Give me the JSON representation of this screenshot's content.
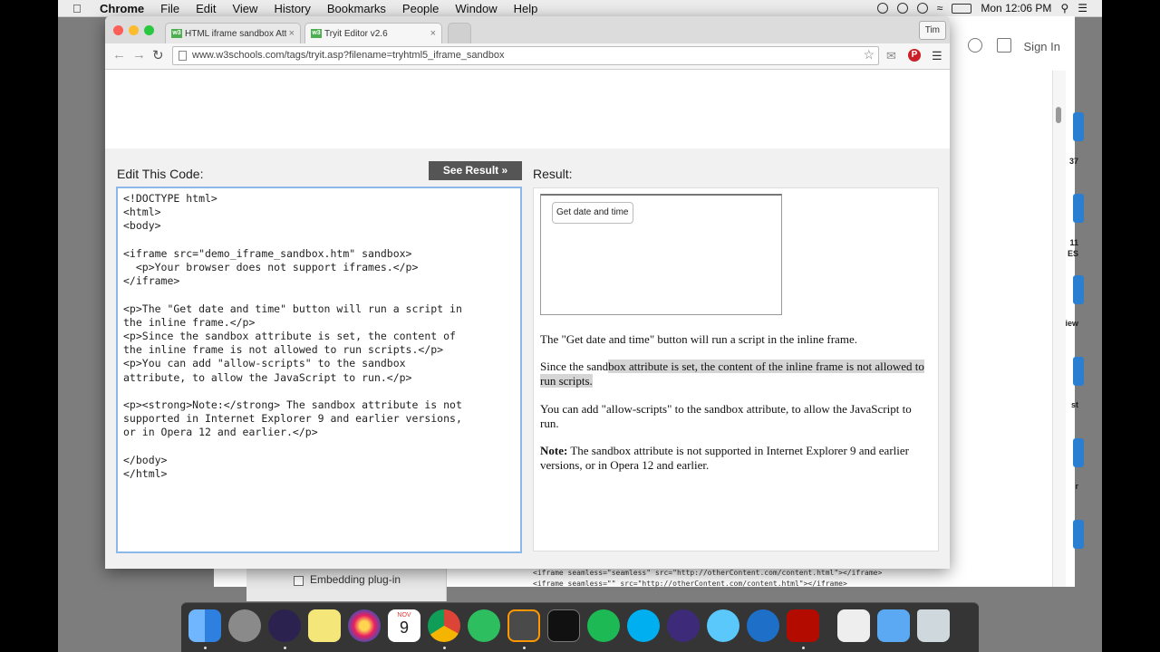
{
  "menubar": {
    "app": "Chrome",
    "items": [
      "File",
      "Edit",
      "View",
      "History",
      "Bookmarks",
      "People",
      "Window",
      "Help"
    ],
    "clock": "Mon 12:06 PM"
  },
  "background_window": {
    "sign_in": "Sign In",
    "edge_labels": [
      "37",
      "11",
      "ES",
      "iew",
      "st",
      "r"
    ],
    "sidebar_option": "Embedding plug-in",
    "code_lines": [
      "<iframe seamless=\"seamless\" src=\"http://otherContent.com/content.html\"></iframe>",
      "<iframe seamless=\"\" src=\"http://otherContent.com/content.html\"></iframe>"
    ]
  },
  "browser": {
    "tabs": [
      {
        "title": "HTML iframe sandbox Attr",
        "favicon": "w3"
      },
      {
        "title": "Tryit Editor v2.6",
        "favicon": "w3"
      }
    ],
    "profile": "Tim",
    "url": "www.w3schools.com/tags/tryit.asp?filename=tryhtml5_iframe_sandbox"
  },
  "editor": {
    "label": "Edit This Code:",
    "see_result": "See Result »",
    "code": "<!DOCTYPE html>\n<html>\n<body>\n\n<iframe src=\"demo_iframe_sandbox.htm\" sandbox>\n  <p>Your browser does not support iframes.</p>\n</iframe>\n\n<p>The \"Get date and time\" button will run a script in\nthe inline frame.</p>\n<p>Since the sandbox attribute is set, the content of\nthe inline frame is not allowed to run scripts.</p>\n<p>You can add \"allow-scripts\" to the sandbox\nattribute, to allow the JavaScript to run.</p>\n\n<p><strong>Note:</strong> The sandbox attribute is not\nsupported in Internet Explorer 9 and earlier versions,\nor in Opera 12 and earlier.</p>\n\n</body>\n</html>"
  },
  "result": {
    "label": "Result:",
    "iframe_button": "Get date and time",
    "p1": "The \"Get date and time\" button will run a script in the inline frame.",
    "p2_before": "Since the sand",
    "p2_highlight": "box attribute is set, the content of the inline frame is not allowed to run scripts.",
    "p3": "You can add \"allow-scripts\" to the sandbox attribute, to allow the JavaScript to run.",
    "note_label": "Note:",
    "note_text": " The sandbox attribute is not supported in Internet Explorer 9 and earlier versions, or in Opera 12 and earlier."
  },
  "dock": {
    "calendar_month": "NOV",
    "calendar_day": "9",
    "apps": [
      "finder",
      "system-preferences",
      "eclipse",
      "stickies",
      "photos",
      "calendar",
      "chrome",
      "evernote",
      "sublime-text",
      "terminal",
      "spotify",
      "skype",
      "audacity",
      "messages",
      "quicktime",
      "acrobat",
      "archive",
      "downloads",
      "trash"
    ]
  }
}
